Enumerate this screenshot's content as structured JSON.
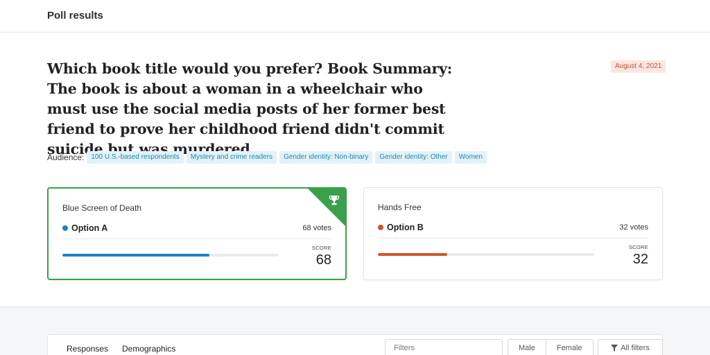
{
  "header": {
    "title": "Poll results"
  },
  "poll": {
    "question": "Which book title would you prefer? Book Summary: The book is about a woman in a wheelchair who must use the social media posts of her former best friend to prove her childhood friend didn't commit suicide but was murdered",
    "date": "August 4, 2021",
    "audience_label": "Audience:",
    "audience": [
      "100 U.S.-based respondents",
      "Mystery and crime readers",
      "Gender identity: Non-binary",
      "Gender identity: Other",
      "Women"
    ]
  },
  "options": [
    {
      "title": "Blue Screen of Death",
      "name": "Option A",
      "votes": "68 votes",
      "score_label": "SCORE",
      "score": "68",
      "fraction": 0.68,
      "color": "#1b84c1",
      "winner": true,
      "winner_icon": "trophy-icon"
    },
    {
      "title": "Hands Free",
      "name": "Option B",
      "votes": "32 votes",
      "score_label": "SCORE",
      "score": "32",
      "fraction": 0.32,
      "color": "#d0552c",
      "winner": false
    }
  ],
  "colors": {
    "winner_border": "#3aa04b",
    "chip_bg": "#e3f2f8",
    "chip_text": "#1a86b3",
    "date_bg": "#fbe6df",
    "date_text": "#b8563d"
  },
  "lower": {
    "tabs": [
      "Responses",
      "Demographics"
    ],
    "filter_placeholder": "Filters",
    "gender_buttons": [
      "Male",
      "Female"
    ],
    "all_filters_label": "All filters",
    "all_filters_icon": "filter-icon"
  }
}
